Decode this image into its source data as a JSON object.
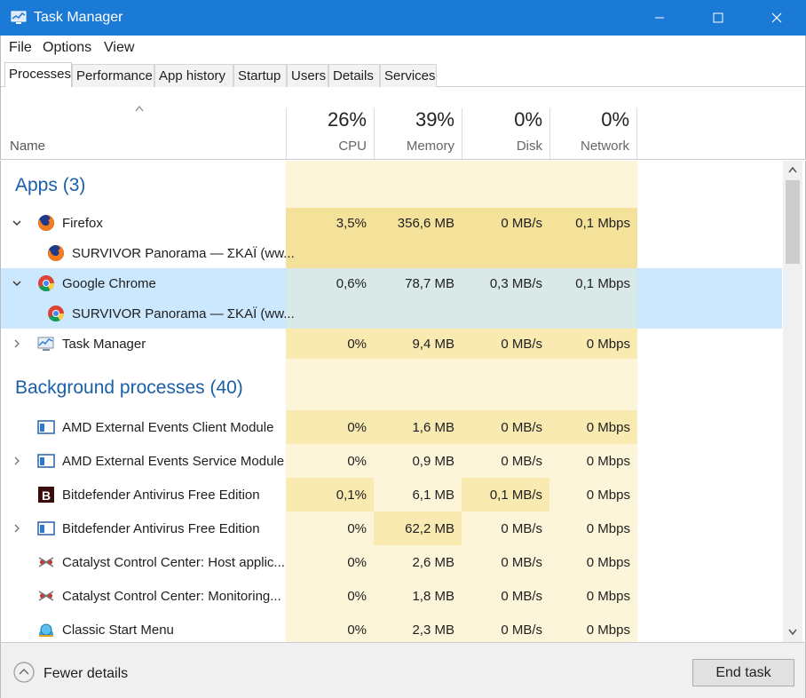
{
  "window": {
    "title": "Task Manager",
    "controls": [
      "minimize",
      "maximize",
      "close"
    ]
  },
  "menu": [
    "File",
    "Options",
    "View"
  ],
  "tabs": [
    {
      "label": "Processes",
      "active": true
    },
    {
      "label": "Performance",
      "active": false
    },
    {
      "label": "App history",
      "active": false
    },
    {
      "label": "Startup",
      "active": false
    },
    {
      "label": "Users",
      "active": false
    },
    {
      "label": "Details",
      "active": false
    },
    {
      "label": "Services",
      "active": false
    }
  ],
  "header": {
    "name_label": "Name",
    "columns": [
      {
        "label": "CPU",
        "percent": "26%"
      },
      {
        "label": "Memory",
        "percent": "39%"
      },
      {
        "label": "Disk",
        "percent": "0%"
      },
      {
        "label": "Network",
        "percent": "0%"
      }
    ]
  },
  "groups": {
    "apps": "Apps (3)",
    "background": "Background processes (40)"
  },
  "rows": [
    {
      "name": "Firefox",
      "icon": "firefox-icon",
      "chevron": "expanded",
      "cpu": "3,5%",
      "memory": "356,6 MB",
      "disk": "0 MB/s",
      "network": "0,1 Mbps"
    },
    {
      "name": "SURVIVOR Panorama — ΣΚΑΪ (ww...",
      "icon": "firefox-icon",
      "chevron": "none",
      "cpu": "",
      "memory": "",
      "disk": "",
      "network": ""
    },
    {
      "name": "Google Chrome",
      "icon": "chrome-icon",
      "chevron": "expanded",
      "cpu": "0,6%",
      "memory": "78,7 MB",
      "disk": "0,3 MB/s",
      "network": "0,1 Mbps"
    },
    {
      "name": "SURVIVOR Panorama — ΣΚΑΪ (ww...",
      "icon": "chrome-icon",
      "chevron": "none",
      "cpu": "",
      "memory": "",
      "disk": "",
      "network": ""
    },
    {
      "name": "Task Manager",
      "icon": "task-manager-icon",
      "chevron": "collapsed",
      "cpu": "0%",
      "memory": "9,4 MB",
      "disk": "0 MB/s",
      "network": "0 Mbps"
    },
    {
      "name": "AMD External Events Client Module",
      "icon": "service-window-icon",
      "chevron": "none",
      "cpu": "0%",
      "memory": "1,6 MB",
      "disk": "0 MB/s",
      "network": "0 Mbps"
    },
    {
      "name": "AMD External Events Service Module",
      "icon": "service-window-icon",
      "chevron": "collapsed",
      "cpu": "0%",
      "memory": "0,9 MB",
      "disk": "0 MB/s",
      "network": "0 Mbps"
    },
    {
      "name": "Bitdefender Antivirus Free Edition",
      "icon": "bitdefender-icon",
      "chevron": "none",
      "cpu": "0,1%",
      "memory": "6,1 MB",
      "disk": "0,1 MB/s",
      "network": "0 Mbps"
    },
    {
      "name": "Bitdefender Antivirus Free Edition",
      "icon": "service-window-icon",
      "chevron": "collapsed",
      "cpu": "0%",
      "memory": "62,2 MB",
      "disk": "0 MB/s",
      "network": "0 Mbps"
    },
    {
      "name": "Catalyst Control Center: Host applic...",
      "icon": "catalyst-icon",
      "chevron": "none",
      "cpu": "0%",
      "memory": "2,6 MB",
      "disk": "0 MB/s",
      "network": "0 Mbps"
    },
    {
      "name": "Catalyst Control Center: Monitoring...",
      "icon": "catalyst-icon",
      "chevron": "none",
      "cpu": "0%",
      "memory": "1,8 MB",
      "disk": "0 MB/s",
      "network": "0 Mbps"
    },
    {
      "name": "Classic Start Menu",
      "icon": "classic-shell-icon",
      "chevron": "none",
      "cpu": "0%",
      "memory": "2,3 MB",
      "disk": "0 MB/s",
      "network": "0 Mbps"
    }
  ],
  "footer": {
    "fewer_details": "Fewer details",
    "end_task": "End task"
  },
  "colors": {
    "titlebar": "#1a7ad6",
    "group_title": "#1b5fa8",
    "heat_light": "#fdf5d9",
    "heat_medium": "#f9eab2",
    "heat_strong": "#f5e29a",
    "selected_row": "#cce8ff"
  }
}
